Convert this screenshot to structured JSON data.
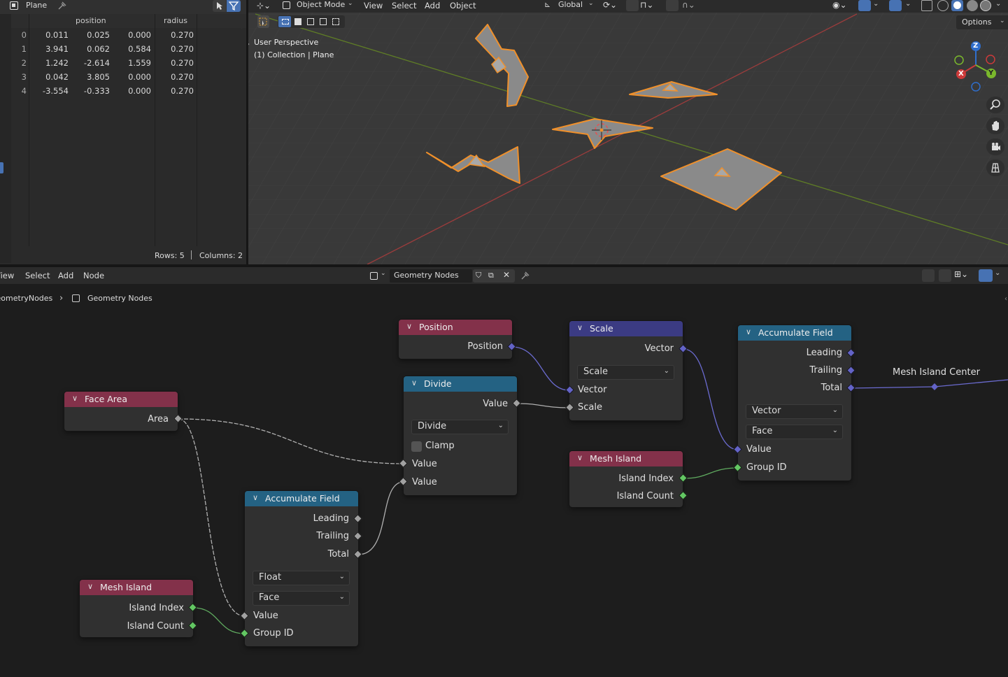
{
  "spreadsheet": {
    "object_name": "Plane",
    "columns": [
      "position",
      "radius"
    ],
    "rows": [
      {
        "index": "0",
        "x": "0.011",
        "y": "0.025",
        "z": "0.000",
        "radius": "0.270"
      },
      {
        "index": "1",
        "x": "3.941",
        "y": "0.062",
        "z": "0.584",
        "radius": "0.270"
      },
      {
        "index": "2",
        "x": "1.242",
        "y": "-2.614",
        "z": "1.559",
        "radius": "0.270"
      },
      {
        "index": "3",
        "x": "0.042",
        "y": "3.805",
        "z": "0.000",
        "radius": "0.270"
      },
      {
        "index": "4",
        "x": "-3.554",
        "y": "-0.333",
        "z": "0.000",
        "radius": "0.270"
      }
    ],
    "rows_label": "Rows: 5",
    "columns_label": "Columns: 2"
  },
  "viewport": {
    "mode": "Object Mode",
    "menu": [
      "View",
      "Select",
      "Add",
      "Object"
    ],
    "orientation": "Global",
    "options_label": "Options",
    "overlay_line1": "User Perspective",
    "overlay_line2": "(1) Collection | Plane",
    "gizmo": {
      "x": "X",
      "y": "Y",
      "z": "Z"
    },
    "colors": {
      "selection": "#f0902a",
      "x_axis": "#b34a4a",
      "y_axis": "#6d8c2b"
    }
  },
  "node_editor": {
    "menu": [
      "View",
      "Select",
      "Add",
      "Node"
    ],
    "tree_name": "Geometry Nodes",
    "breadcrumb": [
      "GeometryNodes",
      "Geometry Nodes"
    ],
    "nodes": {
      "position": {
        "title": "Position",
        "output": "Position"
      },
      "scale": {
        "title": "Scale",
        "output": "Vector",
        "mode": "Scale",
        "inputs": [
          "Vector",
          "Scale"
        ]
      },
      "accum2": {
        "title": "Accumulate Field",
        "outputs": [
          "Leading",
          "Trailing",
          "Total"
        ],
        "type": "Vector",
        "domain": "Face",
        "inputs": [
          "Value",
          "Group ID"
        ]
      },
      "face_area": {
        "title": "Face Area",
        "output": "Area"
      },
      "divide": {
        "title": "Divide",
        "output": "Value",
        "operation": "Divide",
        "clamp": "Clamp",
        "inputs": [
          "Value",
          "Value"
        ]
      },
      "mesh_island2": {
        "title": "Mesh Island",
        "outputs": [
          "Island Index",
          "Island Count"
        ]
      },
      "accum1": {
        "title": "Accumulate Field",
        "outputs": [
          "Leading",
          "Trailing",
          "Total"
        ],
        "type": "Float",
        "domain": "Face",
        "inputs": [
          "Value",
          "Group ID"
        ]
      },
      "mesh_island1": {
        "title": "Mesh Island",
        "outputs": [
          "Island Index",
          "Island Count"
        ]
      }
    },
    "reroute_label": "Mesh Island Center",
    "colors": {
      "geometry_header": "#83314a",
      "converter_header": "#246283",
      "vector_header": "#3b3b83",
      "socket_float": "#a1a1a1",
      "socket_vector": "#6363c7",
      "socket_int": "#63c763"
    }
  }
}
